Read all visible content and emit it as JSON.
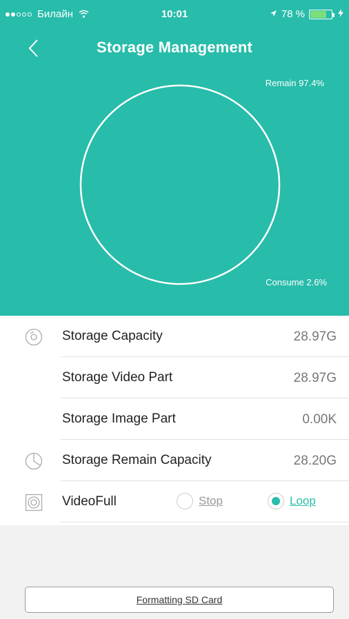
{
  "status_bar": {
    "carrier": "Билайн",
    "time": "10:01",
    "battery": "78 %",
    "battery_level": 0.78,
    "signal_bars": 2
  },
  "nav": {
    "title": "Storage Management",
    "back_icon": "chevron-left-icon"
  },
  "chart": {
    "remain_label": "Remain 97.4%",
    "consume_label": "Consume 2.6%",
    "remain_fraction": 0.974,
    "consume_fraction": 0.026,
    "ring_color": "#ffffff",
    "bg_color": "#28bcaa"
  },
  "rows": [
    {
      "icon": "disc-icon",
      "label": "Storage Capacity",
      "value": "28.97G"
    },
    {
      "icon": "",
      "label": "Storage Video Part",
      "value": "28.97G"
    },
    {
      "icon": "",
      "label": "Storage Image Part",
      "value": "0.00K"
    },
    {
      "icon": "pie-clock-icon",
      "label": "Storage Remain Capacity",
      "value": "28.20G"
    }
  ],
  "video_full": {
    "icon": "concentric-square-icon",
    "label": "VideoFull",
    "options": [
      {
        "label": "Stop",
        "selected": false
      },
      {
        "label": "Loop",
        "selected": true
      }
    ]
  },
  "format_button": {
    "label": "Formatting SD Card"
  },
  "colors": {
    "accent": "#28bcaa"
  }
}
